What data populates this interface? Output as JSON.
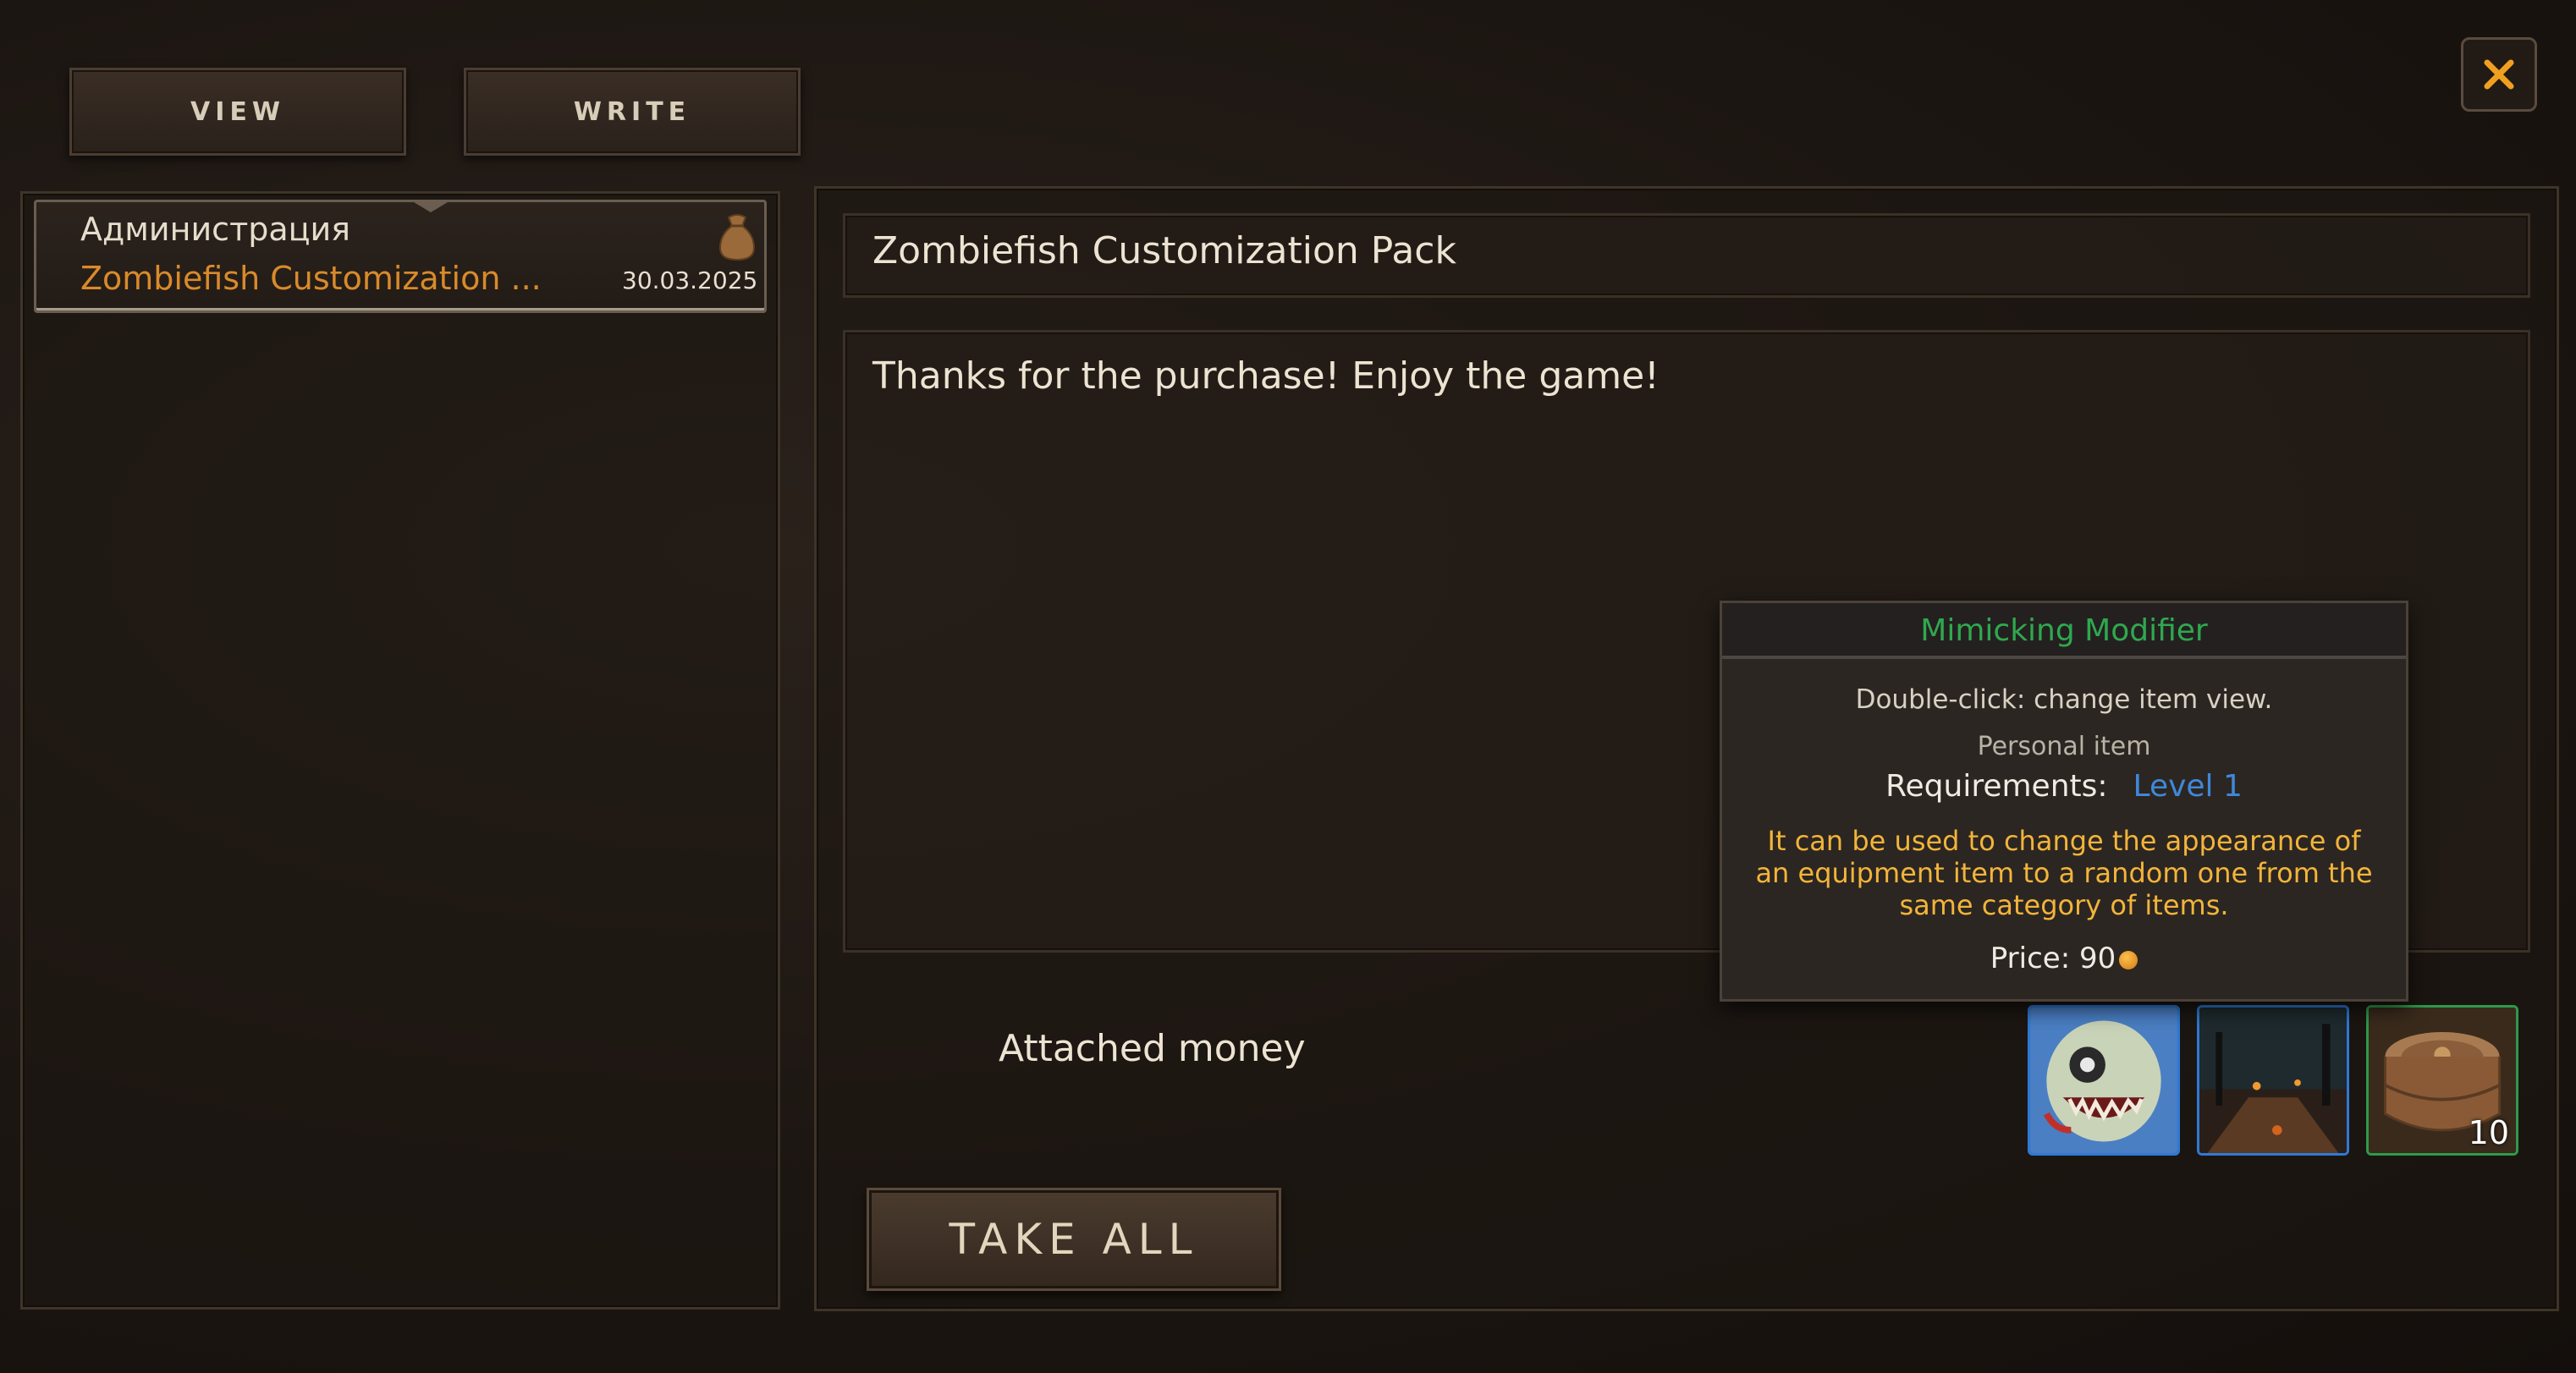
{
  "tabs": {
    "view": "VIEW",
    "write": "WRITE"
  },
  "mail_list": [
    {
      "sender": "Администрация",
      "subject": "Zombiefish Customization ...",
      "date": "30.03.2025",
      "icon": "money-bag-icon"
    }
  ],
  "message": {
    "subject": "Zombiefish Customization Pack",
    "body": "Thanks for the purchase! Enjoy the game!",
    "attached_money_label": "Attached money",
    "take_all_label": "TAKE ALL"
  },
  "attachments": [
    {
      "name": "zombie-fish-mask",
      "border": "#2f79d6",
      "count": ""
    },
    {
      "name": "haunted-swamp-scene",
      "border": "#2f79d6",
      "count": ""
    },
    {
      "name": "wooden-keg",
      "border": "#2d9a4a",
      "count": "10"
    }
  ],
  "tooltip": {
    "title": "Mimicking Modifier",
    "hint": "Double-click: change item view.",
    "personal": "Personal item",
    "requirements_label": "Requirements:",
    "requirements_value": "Level 1",
    "description": "It can be used to change the appearance of an equipment item to a random one from the same category of items.",
    "price_label": "Price: 90",
    "title_color": "#2fa84f",
    "level_color": "#3f88d8",
    "description_color": "#f3b43a"
  },
  "colors": {
    "subject_accent": "#d98a2b",
    "background": "#1a1411"
  }
}
